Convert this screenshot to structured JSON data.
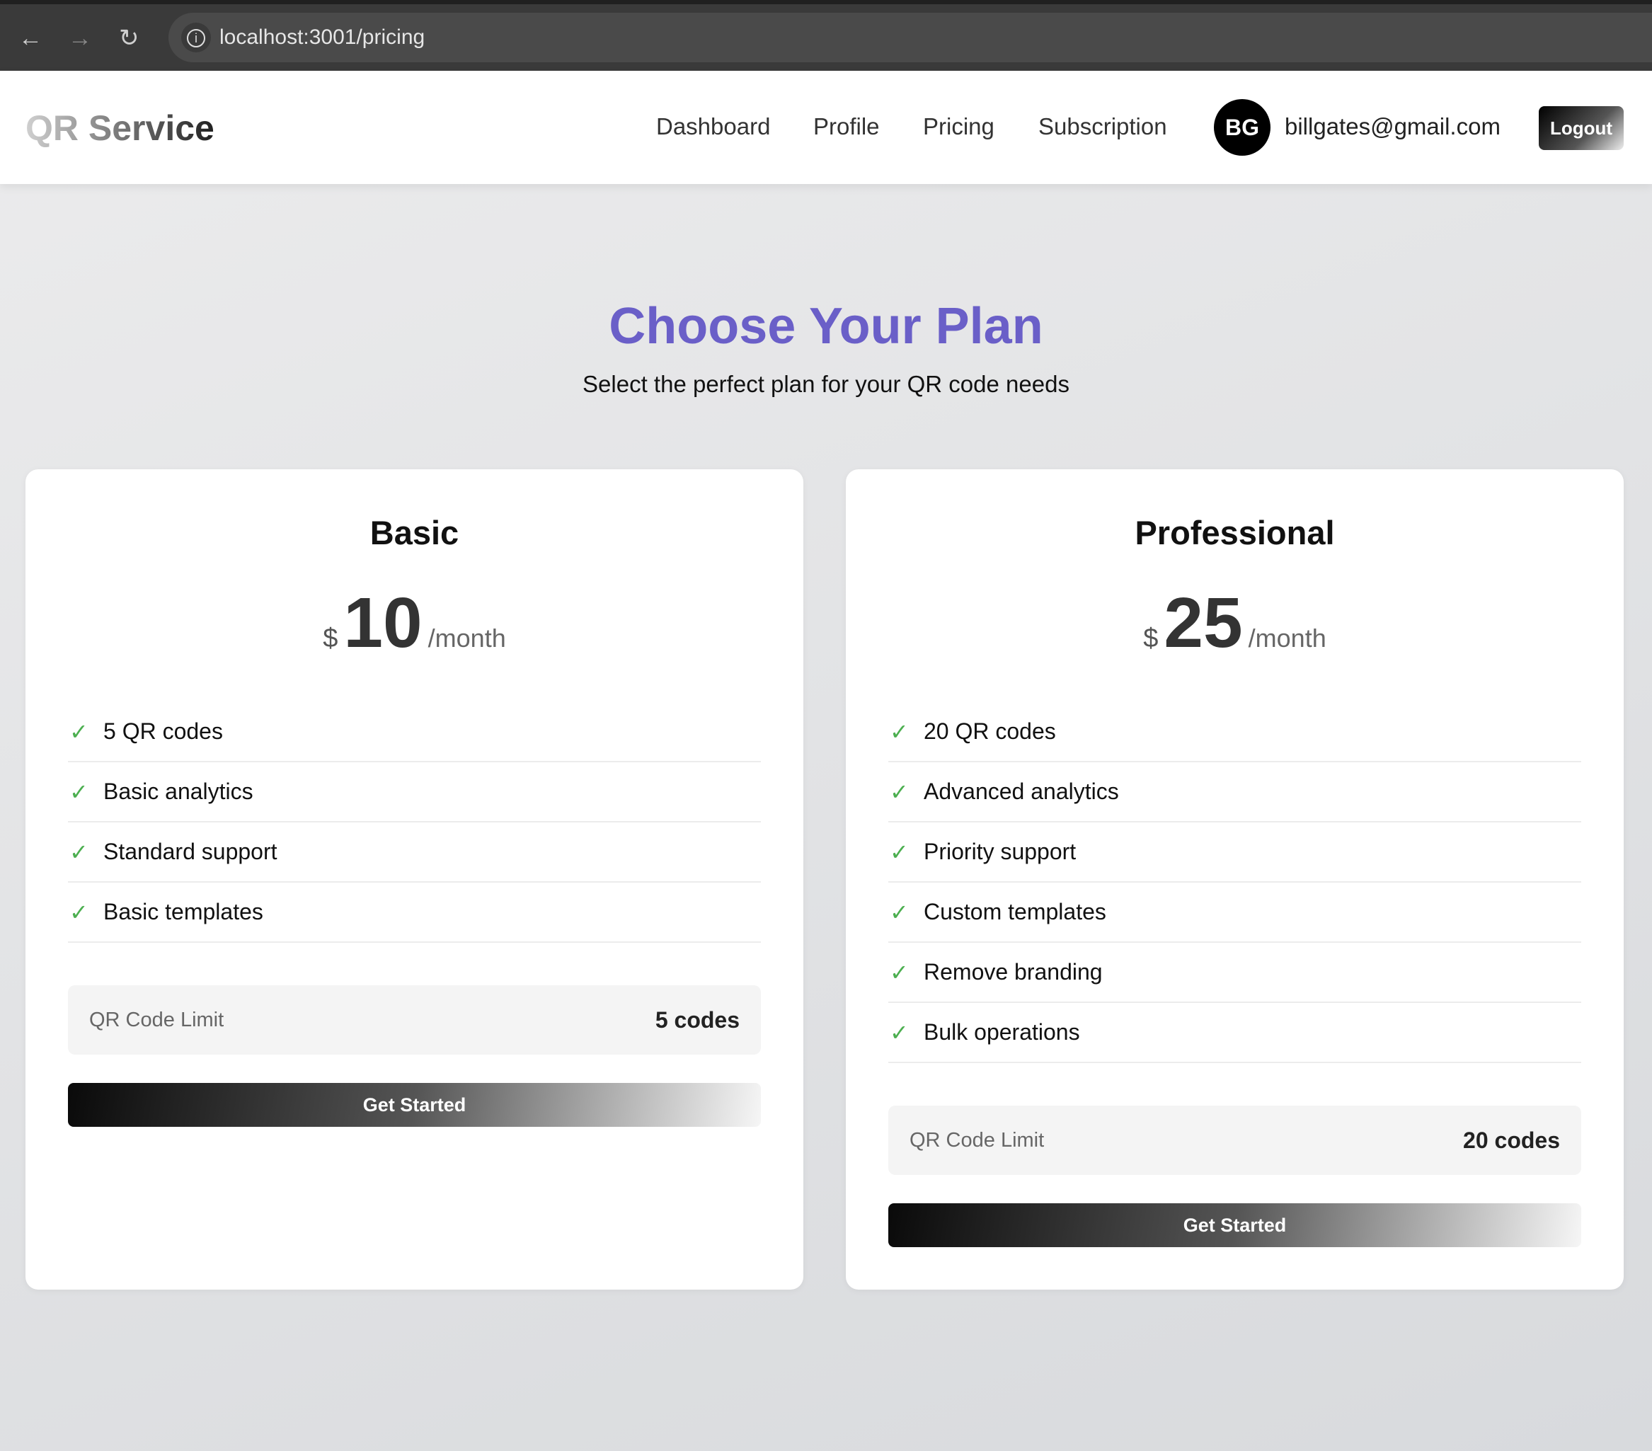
{
  "browser": {
    "url": "localhost:3001/pricing"
  },
  "nav": {
    "logo": "QR Service",
    "links": [
      "Dashboard",
      "Profile",
      "Pricing",
      "Subscription"
    ],
    "avatar_initials": "BG",
    "email": "billgates@gmail.com",
    "logout": "Logout"
  },
  "hero": {
    "title": "Choose Your Plan",
    "subtitle": "Select the perfect plan for your QR code needs"
  },
  "plans": [
    {
      "name": "Basic",
      "currency": "$",
      "price": "10",
      "period": "/month",
      "features": [
        "5 QR codes",
        "Basic analytics",
        "Standard support",
        "Basic templates"
      ],
      "limit_label": "QR Code Limit",
      "limit_value": "5 codes",
      "cta": "Get Started"
    },
    {
      "name": "Professional",
      "currency": "$",
      "price": "25",
      "period": "/month",
      "features": [
        "20 QR codes",
        "Advanced analytics",
        "Priority support",
        "Custom templates",
        "Remove branding",
        "Bulk operations"
      ],
      "limit_label": "QR Code Limit",
      "limit_value": "20 codes",
      "cta": "Get Started"
    }
  ],
  "colors": {
    "accent": "#6a5fc8",
    "check": "#4caf50"
  }
}
